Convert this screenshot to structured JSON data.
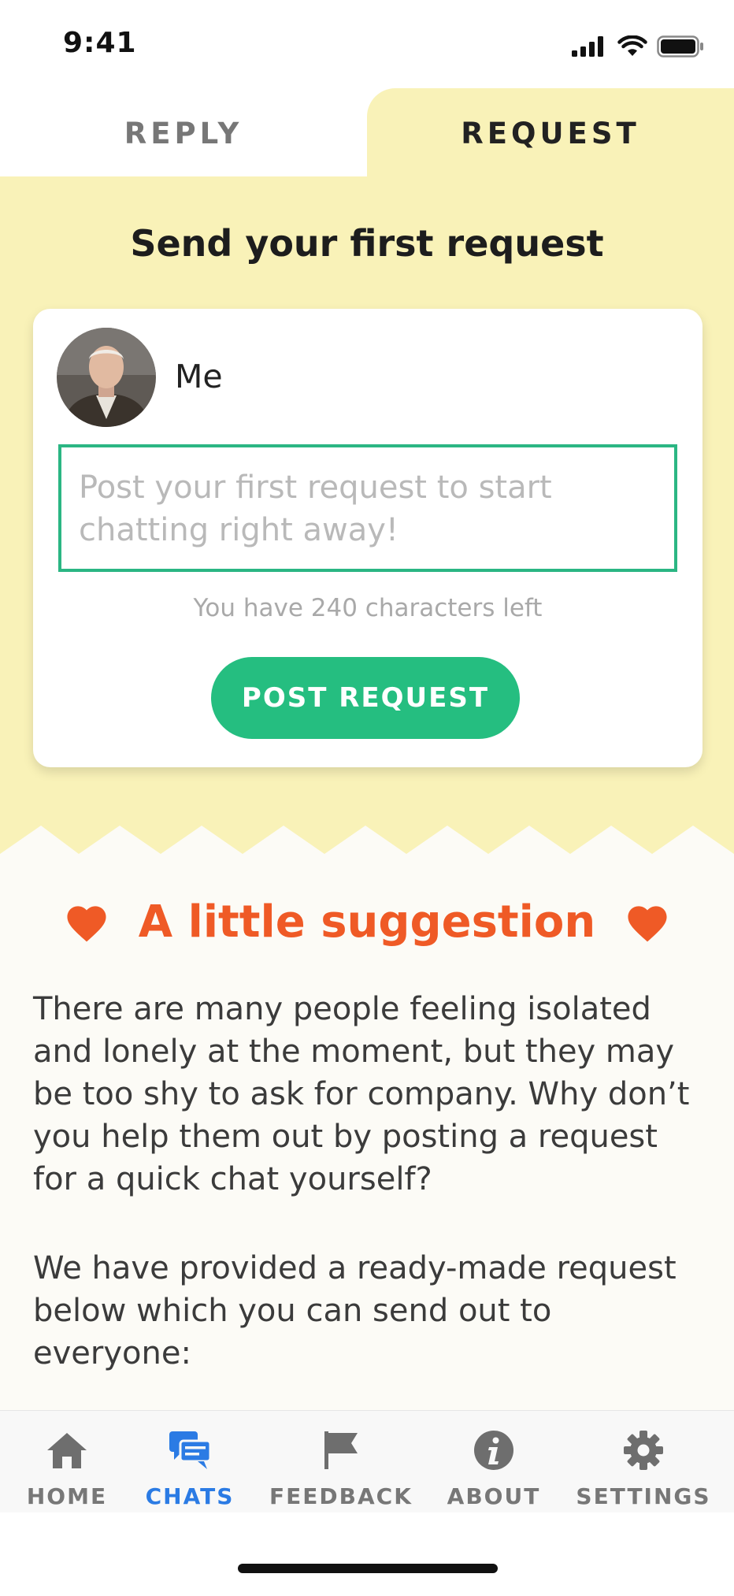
{
  "status_bar": {
    "time": "9:41",
    "icons": [
      "signal-icon",
      "wifi-icon",
      "battery-icon"
    ]
  },
  "tabs": [
    {
      "label": "REPLY",
      "active": false
    },
    {
      "label": "REQUEST",
      "active": true
    }
  ],
  "request_section": {
    "title": "Send your first request",
    "user_name": "Me",
    "input_placeholder": "Post your first request to start chatting right away!",
    "chars_left_text": "You have 240 characters left",
    "post_button_label": "POST REQUEST"
  },
  "suggestion": {
    "title": "A little suggestion",
    "icon": "heart-icon",
    "paragraph1": "There are many people feeling isolated and lonely at the moment, but they may be too shy to ask for company. Why don’t you help them out by posting a request for a quick chat yourself?",
    "paragraph2": "We have provided a ready-made request below which you can send out to everyone:"
  },
  "bottom_nav": {
    "items": [
      {
        "label": "HOME",
        "icon": "home-icon",
        "active": false
      },
      {
        "label": "CHATS",
        "icon": "chats-icon",
        "active": true
      },
      {
        "label": "FEEDBACK",
        "icon": "flag-icon",
        "active": false
      },
      {
        "label": "ABOUT",
        "icon": "info-icon",
        "active": false
      },
      {
        "label": "SETTINGS",
        "icon": "gear-icon",
        "active": false
      }
    ]
  },
  "colors": {
    "tab_background": "#f9f2b8",
    "accent_green": "#25be80",
    "suggestion_orange": "#ef5a26",
    "nav_active_blue": "#2b7be4",
    "nav_inactive_gray": "#777777"
  }
}
